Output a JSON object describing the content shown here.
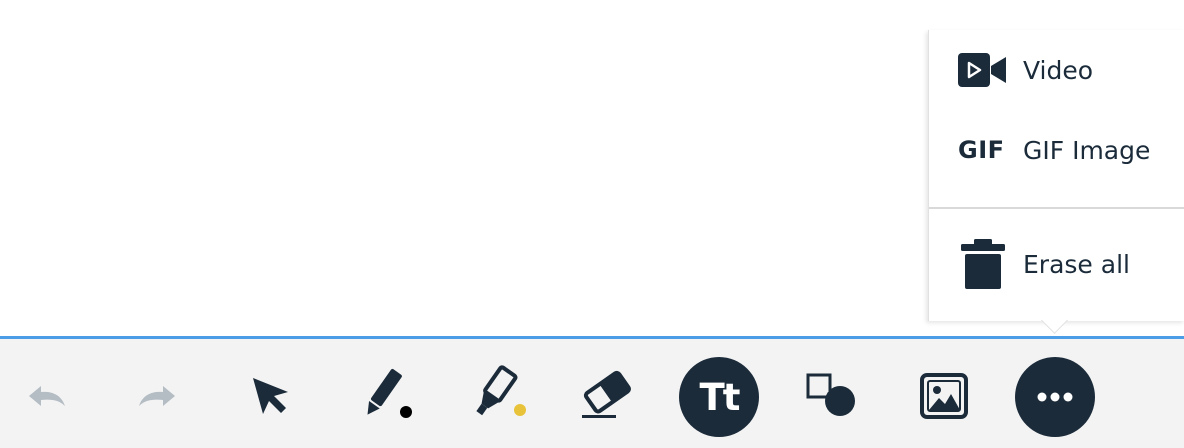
{
  "colors": {
    "accent": "#4a9de6",
    "icon_dark": "#1b2b3a",
    "icon_disabled": "#b4bcc4",
    "toolbar_bg": "#f3f3f3",
    "pen_dot": "#000000",
    "highlighter_dot": "#e8c33a"
  },
  "menu": {
    "items": [
      {
        "label": "Video",
        "icon": "video-icon"
      },
      {
        "label": "GIF Image",
        "icon": "gif-icon",
        "icon_text": "GIF"
      },
      {
        "label": "Erase all",
        "icon": "trash-icon"
      }
    ]
  },
  "toolbar": {
    "tools": [
      {
        "name": "undo",
        "icon": "undo-icon",
        "disabled": true
      },
      {
        "name": "redo",
        "icon": "redo-icon",
        "disabled": true
      },
      {
        "name": "select",
        "icon": "cursor-icon"
      },
      {
        "name": "pen",
        "icon": "pen-icon"
      },
      {
        "name": "highlighter",
        "icon": "highlighter-icon"
      },
      {
        "name": "eraser",
        "icon": "eraser-icon"
      },
      {
        "name": "text",
        "icon": "text-icon",
        "label": "Tt"
      },
      {
        "name": "shapes",
        "icon": "shapes-icon"
      },
      {
        "name": "image",
        "icon": "image-icon"
      },
      {
        "name": "more",
        "icon": "more-icon",
        "active": true
      }
    ]
  }
}
